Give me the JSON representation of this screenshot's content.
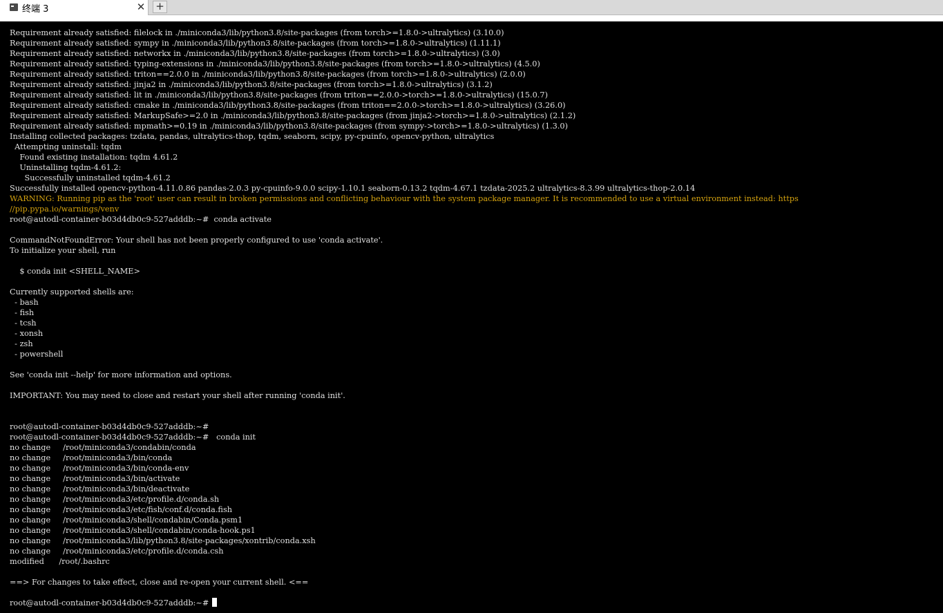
{
  "tab": {
    "title": "终端 3",
    "icon": "terminal-icon",
    "close_glyph": "✕",
    "new_tab_glyph": "+"
  },
  "colors": {
    "terminal_bg": "#000000",
    "terminal_fg": "#e0e0e0",
    "warning": "#d4a20f"
  },
  "terminal": {
    "lines": [
      {
        "text": "Requirement already satisfied: filelock in ./miniconda3/lib/python3.8/site-packages (from torch>=1.8.0->ultralytics) (3.10.0)",
        "type": "normal"
      },
      {
        "text": "Requirement already satisfied: sympy in ./miniconda3/lib/python3.8/site-packages (from torch>=1.8.0->ultralytics) (1.11.1)",
        "type": "normal"
      },
      {
        "text": "Requirement already satisfied: networkx in ./miniconda3/lib/python3.8/site-packages (from torch>=1.8.0->ultralytics) (3.0)",
        "type": "normal"
      },
      {
        "text": "Requirement already satisfied: typing-extensions in ./miniconda3/lib/python3.8/site-packages (from torch>=1.8.0->ultralytics) (4.5.0)",
        "type": "normal"
      },
      {
        "text": "Requirement already satisfied: triton==2.0.0 in ./miniconda3/lib/python3.8/site-packages (from torch>=1.8.0->ultralytics) (2.0.0)",
        "type": "normal"
      },
      {
        "text": "Requirement already satisfied: jinja2 in ./miniconda3/lib/python3.8/site-packages (from torch>=1.8.0->ultralytics) (3.1.2)",
        "type": "normal"
      },
      {
        "text": "Requirement already satisfied: lit in ./miniconda3/lib/python3.8/site-packages (from triton==2.0.0->torch>=1.8.0->ultralytics) (15.0.7)",
        "type": "normal"
      },
      {
        "text": "Requirement already satisfied: cmake in ./miniconda3/lib/python3.8/site-packages (from triton==2.0.0->torch>=1.8.0->ultralytics) (3.26.0)",
        "type": "normal"
      },
      {
        "text": "Requirement already satisfied: MarkupSafe>=2.0 in ./miniconda3/lib/python3.8/site-packages (from jinja2->torch>=1.8.0->ultralytics) (2.1.2)",
        "type": "normal"
      },
      {
        "text": "Requirement already satisfied: mpmath>=0.19 in ./miniconda3/lib/python3.8/site-packages (from sympy->torch>=1.8.0->ultralytics) (1.3.0)",
        "type": "normal"
      },
      {
        "text": "Installing collected packages: tzdata, pandas, ultralytics-thop, tqdm, seaborn, scipy, py-cpuinfo, opencv-python, ultralytics",
        "type": "normal"
      },
      {
        "text": "  Attempting uninstall: tqdm",
        "type": "normal"
      },
      {
        "text": "    Found existing installation: tqdm 4.61.2",
        "type": "normal"
      },
      {
        "text": "    Uninstalling tqdm-4.61.2:",
        "type": "normal"
      },
      {
        "text": "      Successfully uninstalled tqdm-4.61.2",
        "type": "normal"
      },
      {
        "text": "Successfully installed opencv-python-4.11.0.86 pandas-2.0.3 py-cpuinfo-9.0.0 scipy-1.10.1 seaborn-0.13.2 tqdm-4.67.1 tzdata-2025.2 ultralytics-8.3.99 ultralytics-thop-2.0.14",
        "type": "normal"
      },
      {
        "text": "WARNING: Running pip as the 'root' user can result in broken permissions and conflicting behaviour with the system package manager. It is recommended to use a virtual environment instead: https",
        "type": "warning"
      },
      {
        "text": "//pip.pypa.io/warnings/venv",
        "type": "warning"
      },
      {
        "text": "root@autodl-container-b03d4db0c9-527adddb:~#  conda activate",
        "type": "prompt"
      },
      {
        "text": "",
        "type": "normal"
      },
      {
        "text": "CommandNotFoundError: Your shell has not been properly configured to use 'conda activate'.",
        "type": "normal"
      },
      {
        "text": "To initialize your shell, run",
        "type": "normal"
      },
      {
        "text": "",
        "type": "normal"
      },
      {
        "text": "    $ conda init <SHELL_NAME>",
        "type": "normal"
      },
      {
        "text": "",
        "type": "normal"
      },
      {
        "text": "Currently supported shells are:",
        "type": "normal"
      },
      {
        "text": "  - bash",
        "type": "normal"
      },
      {
        "text": "  - fish",
        "type": "normal"
      },
      {
        "text": "  - tcsh",
        "type": "normal"
      },
      {
        "text": "  - xonsh",
        "type": "normal"
      },
      {
        "text": "  - zsh",
        "type": "normal"
      },
      {
        "text": "  - powershell",
        "type": "normal"
      },
      {
        "text": "",
        "type": "normal"
      },
      {
        "text": "See 'conda init --help' for more information and options.",
        "type": "normal"
      },
      {
        "text": "",
        "type": "normal"
      },
      {
        "text": "IMPORTANT: You may need to close and restart your shell after running 'conda init'.",
        "type": "normal"
      },
      {
        "text": "",
        "type": "normal"
      },
      {
        "text": "",
        "type": "normal"
      },
      {
        "text": "root@autodl-container-b03d4db0c9-527adddb:~#",
        "type": "prompt"
      },
      {
        "text": "root@autodl-container-b03d4db0c9-527adddb:~#   conda init",
        "type": "prompt"
      },
      {
        "text": "no change     /root/miniconda3/condabin/conda",
        "type": "normal"
      },
      {
        "text": "no change     /root/miniconda3/bin/conda",
        "type": "normal"
      },
      {
        "text": "no change     /root/miniconda3/bin/conda-env",
        "type": "normal"
      },
      {
        "text": "no change     /root/miniconda3/bin/activate",
        "type": "normal"
      },
      {
        "text": "no change     /root/miniconda3/bin/deactivate",
        "type": "normal"
      },
      {
        "text": "no change     /root/miniconda3/etc/profile.d/conda.sh",
        "type": "normal"
      },
      {
        "text": "no change     /root/miniconda3/etc/fish/conf.d/conda.fish",
        "type": "normal"
      },
      {
        "text": "no change     /root/miniconda3/shell/condabin/Conda.psm1",
        "type": "normal"
      },
      {
        "text": "no change     /root/miniconda3/shell/condabin/conda-hook.ps1",
        "type": "normal"
      },
      {
        "text": "no change     /root/miniconda3/lib/python3.8/site-packages/xontrib/conda.xsh",
        "type": "normal"
      },
      {
        "text": "no change     /root/miniconda3/etc/profile.d/conda.csh",
        "type": "normal"
      },
      {
        "text": "modified      /root/.bashrc",
        "type": "normal"
      },
      {
        "text": "",
        "type": "normal"
      },
      {
        "text": "==> For changes to take effect, close and re-open your current shell. <==",
        "type": "normal"
      },
      {
        "text": "",
        "type": "normal"
      }
    ],
    "current_prompt": "root@autodl-container-b03d4db0c9-527adddb:~# "
  }
}
